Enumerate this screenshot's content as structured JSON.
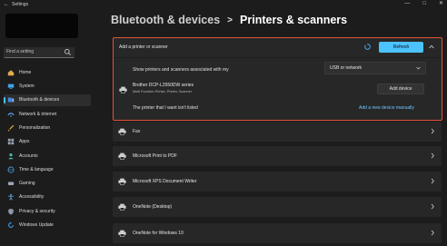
{
  "window": {
    "title": "Settings"
  },
  "search": {
    "placeholder": "Find a setting"
  },
  "nav": [
    {
      "label": "Home",
      "icon": "home-icon",
      "active": false
    },
    {
      "label": "System",
      "icon": "system-icon",
      "active": false
    },
    {
      "label": "Bluetooth & devices",
      "icon": "bluetooth-icon",
      "active": true
    },
    {
      "label": "Network & internet",
      "icon": "network-icon",
      "active": false
    },
    {
      "label": "Personalization",
      "icon": "brush-icon",
      "active": false
    },
    {
      "label": "Apps",
      "icon": "apps-icon",
      "active": false
    },
    {
      "label": "Accounts",
      "icon": "accounts-icon",
      "active": false
    },
    {
      "label": "Time & language",
      "icon": "globe-icon",
      "active": false
    },
    {
      "label": "Gaming",
      "icon": "gaming-icon",
      "active": false
    },
    {
      "label": "Accessibility",
      "icon": "accessibility-icon",
      "active": false
    },
    {
      "label": "Privacy & security",
      "icon": "shield-icon",
      "active": false
    },
    {
      "label": "Windows Update",
      "icon": "update-icon",
      "active": false
    }
  ],
  "breadcrumb": {
    "parent": "Bluetooth & devices",
    "separator": ">",
    "current": "Printers & scanners"
  },
  "add_panel": {
    "title": "Add a printer or scanner",
    "refresh_label": "Refresh",
    "show_label": "Show printers and scanners associated with my",
    "dropdown_value": "USB or network",
    "found_printer": {
      "name": "Brother DCP-L2550DW series",
      "description": "Multi Function Printer, Printer, Scanner"
    },
    "add_device_label": "Add device",
    "unlisted_label": "The printer that I want isn't listed",
    "manual_link_label": "Add a new device manually"
  },
  "printers": [
    {
      "name": "Fax"
    },
    {
      "name": "Microsoft Print to PDF"
    },
    {
      "name": "Microsoft XPS Document Writer"
    },
    {
      "name": "OneNote (Desktop)"
    },
    {
      "name": "OneNote for Windows 10"
    }
  ],
  "colors": {
    "accent": "#4cc2ff",
    "highlight_border": "#e2533a",
    "background": "#1c1c1c",
    "card": "#272727"
  }
}
